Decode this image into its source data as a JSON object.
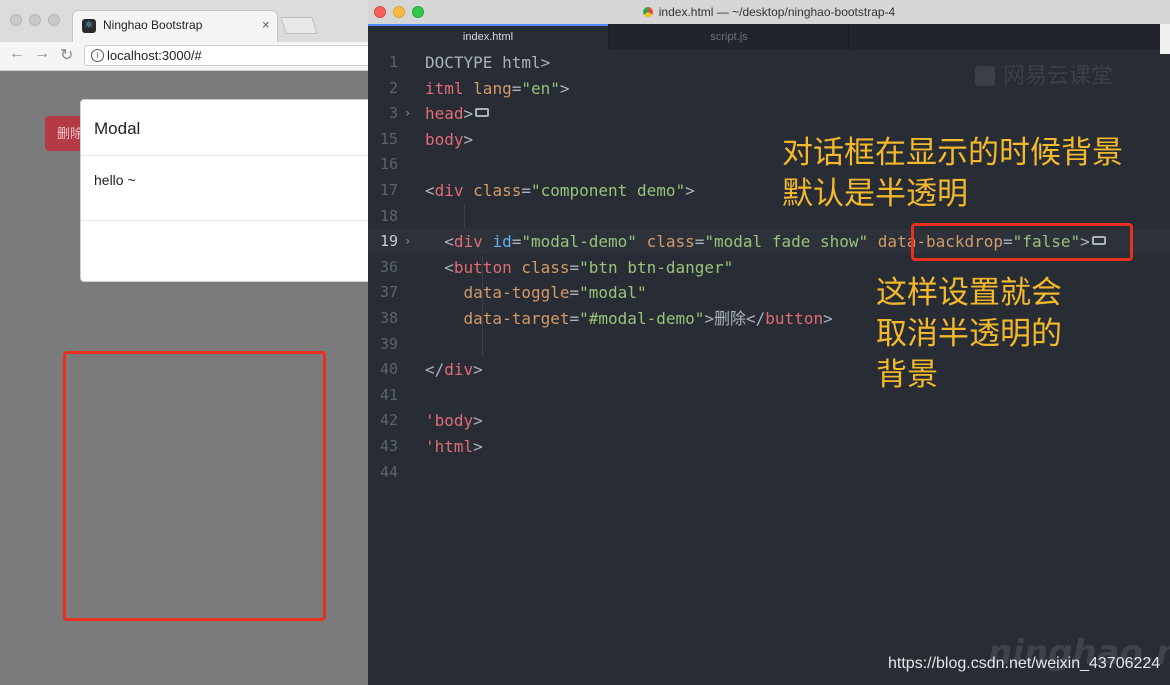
{
  "browser": {
    "tab_title": "Ninghao Bootstrap",
    "tab_close": "×",
    "url": "localhost:3000/#",
    "nav": {
      "back": "←",
      "forward": "→",
      "reload": "↻"
    },
    "page": {
      "danger_button_label": "删除",
      "modal_title": "Modal",
      "modal_body": "hello ~"
    }
  },
  "editor": {
    "window_title": "index.html — ~/desktop/ninghao-bootstrap-4",
    "tabs": [
      {
        "label": "index.html",
        "active": true
      },
      {
        "label": "script.js",
        "active": false
      }
    ],
    "lines": [
      {
        "n": "1",
        "segs": [
          [
            "t-plain",
            "DOCTYPE html>"
          ]
        ]
      },
      {
        "n": "2",
        "segs": [
          [
            "t-tag",
            "itml "
          ],
          [
            "t-attr",
            "lang"
          ],
          [
            "t-plain",
            "="
          ],
          [
            "t-str",
            "\"en\""
          ],
          [
            "t-plain",
            ">"
          ]
        ]
      },
      {
        "n": "3",
        "fold": true,
        "segs": [
          [
            "t-tag",
            "head"
          ],
          [
            "t-plain",
            ">"
          ]
        ],
        "collapsed": true
      },
      {
        "n": "15",
        "segs": [
          [
            "t-tag",
            "body"
          ],
          [
            "t-plain",
            ">"
          ]
        ]
      },
      {
        "n": "16",
        "segs": []
      },
      {
        "n": "17",
        "segs": [
          [
            "t-plain",
            "<"
          ],
          [
            "t-tag",
            "div "
          ],
          [
            "t-attr",
            "class"
          ],
          [
            "t-plain",
            "="
          ],
          [
            "t-str",
            "\"component demo\""
          ],
          [
            "t-plain",
            ">"
          ]
        ]
      },
      {
        "n": "18",
        "segs": []
      },
      {
        "n": "19",
        "fold": true,
        "current": true,
        "segs": [
          [
            "t-plain",
            "  <"
          ],
          [
            "t-tag",
            "div "
          ],
          [
            "t-id",
            "id"
          ],
          [
            "t-plain",
            "="
          ],
          [
            "t-str",
            "\"modal-demo\""
          ],
          [
            "t-plain",
            " "
          ],
          [
            "t-attr",
            "class"
          ],
          [
            "t-plain",
            "="
          ],
          [
            "t-str",
            "\"modal fade show\""
          ],
          [
            "t-plain",
            " "
          ],
          [
            "t-attr",
            "data-backdrop"
          ],
          [
            "t-plain",
            "="
          ],
          [
            "t-str",
            "\"false\""
          ],
          [
            "t-plain",
            ">"
          ]
        ],
        "collapsed": true
      },
      {
        "n": "36",
        "segs": [
          [
            "t-plain",
            "  <"
          ],
          [
            "t-tag",
            "button "
          ],
          [
            "t-attr",
            "class"
          ],
          [
            "t-plain",
            "="
          ],
          [
            "t-str",
            "\"btn btn-danger\""
          ]
        ]
      },
      {
        "n": "37",
        "segs": [
          [
            "t-plain",
            "    "
          ],
          [
            "t-attr",
            "data-toggle"
          ],
          [
            "t-plain",
            "="
          ],
          [
            "t-str",
            "\"modal\""
          ]
        ]
      },
      {
        "n": "38",
        "segs": [
          [
            "t-plain",
            "    "
          ],
          [
            "t-attr",
            "data-target"
          ],
          [
            "t-plain",
            "="
          ],
          [
            "t-str",
            "\"#modal-demo\""
          ],
          [
            "t-plain",
            ">删除</"
          ],
          [
            "t-tag",
            "button"
          ],
          [
            "t-plain",
            ">"
          ]
        ]
      },
      {
        "n": "39",
        "segs": []
      },
      {
        "n": "40",
        "segs": [
          [
            "t-plain",
            "</"
          ],
          [
            "t-tag",
            "div"
          ],
          [
            "t-plain",
            ">"
          ]
        ]
      },
      {
        "n": "41",
        "segs": []
      },
      {
        "n": "42",
        "segs": [
          [
            "t-tag",
            "'body"
          ],
          [
            "t-plain",
            ">"
          ]
        ]
      },
      {
        "n": "43",
        "segs": [
          [
            "t-tag",
            "'html"
          ],
          [
            "t-plain",
            ">"
          ]
        ]
      },
      {
        "n": "44",
        "segs": []
      }
    ]
  },
  "annotations": {
    "top": "对话框在显示的时候背景\n默认是半透明",
    "bottom": "这样设置就会\n取消半透明的\n背景"
  },
  "watermarks": {
    "logo": "网易云课堂",
    "ninghao": "ninghao.net",
    "csdn": "https://blog.csdn.net/weixin_43706224"
  }
}
